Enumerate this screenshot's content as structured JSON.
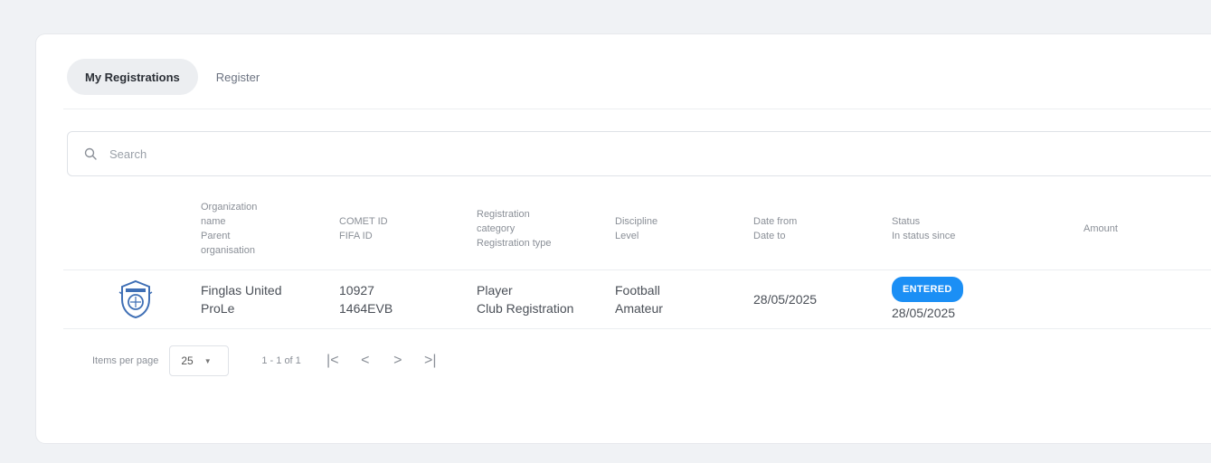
{
  "tabs": [
    {
      "label": "My Registrations",
      "active": true
    },
    {
      "label": "Register",
      "active": false
    }
  ],
  "search": {
    "placeholder": "Search",
    "value": ""
  },
  "table": {
    "headers": {
      "organization": [
        "Organization",
        "name",
        "Parent",
        "organisation"
      ],
      "ids": [
        "COMET ID",
        "FIFA ID"
      ],
      "registration": [
        "Registration",
        "category",
        "Registration type"
      ],
      "discipline": [
        "Discipline",
        "Level"
      ],
      "dates": [
        "Date from",
        "Date to"
      ],
      "status": [
        "Status",
        "In status since"
      ],
      "amount": [
        "Amount"
      ]
    },
    "rows": [
      {
        "org_name": "Finglas United",
        "parent_org": "ProLe",
        "comet_id": "10927",
        "fifa_id": "1464EVB",
        "category": "Player",
        "reg_type": "Club Registration",
        "discipline": "Football",
        "level": "Amateur",
        "date_from": "28/05/2025",
        "status": "ENTERED",
        "status_since": "28/05/2025",
        "amount": ""
      }
    ]
  },
  "pagination": {
    "items_per_page_label": "Items per page",
    "page_size": "25",
    "range": "1 - 1 of 1",
    "first_icon": "first-page-icon",
    "prev_icon": "chevron-left-icon",
    "next_icon": "chevron-right-icon",
    "last_icon": "last-page-icon"
  },
  "colors": {
    "accent": "#1b8ff5",
    "background": "#f0f2f5",
    "card": "#ffffff"
  }
}
